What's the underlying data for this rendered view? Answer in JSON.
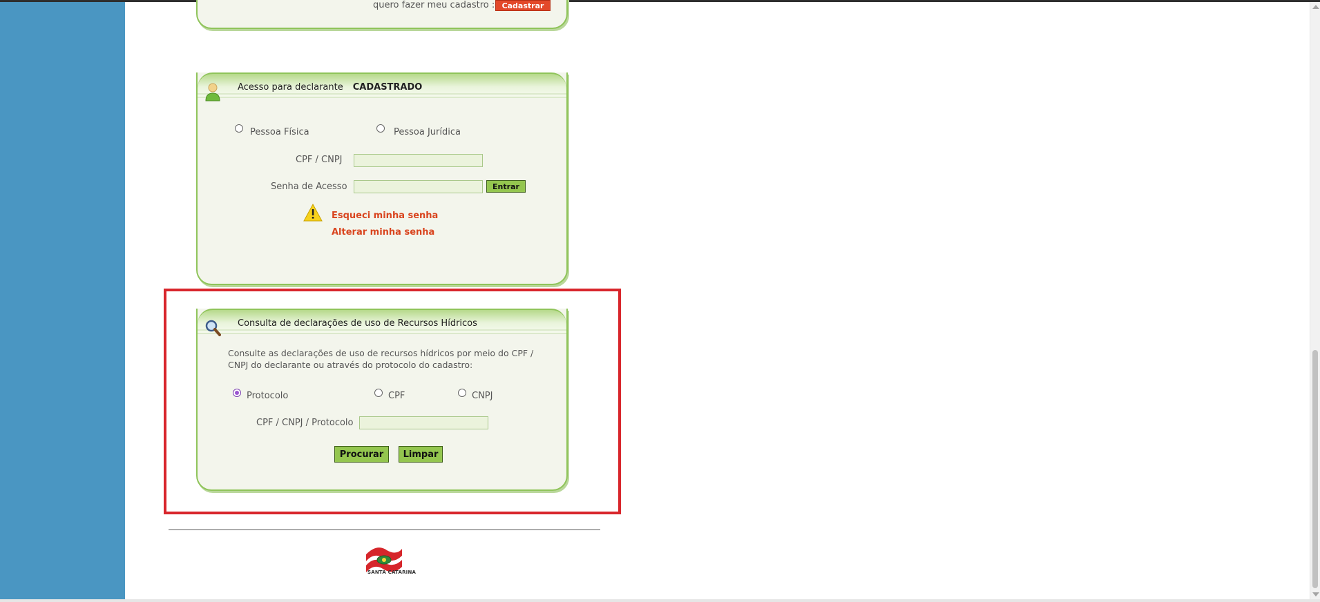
{
  "top_panel": {
    "text": "quero fazer meu cadastro :",
    "register_button": "Cadastrar"
  },
  "access_panel": {
    "title": "Acesso para declarante",
    "title_bold": "CADASTRADO",
    "radio_pf": "Pessoa Física",
    "radio_pj": "Pessoa Jurídica",
    "cpf_label": "CPF / CNPJ",
    "cpf_value": "",
    "password_label": "Senha de Acesso",
    "password_value": "",
    "enter_button": "Entrar",
    "forgot_link": "Esqueci minha senha",
    "change_link": "Alterar minha senha"
  },
  "query_panel": {
    "title": "Consulta de declarações de uso de Recursos Hídricos",
    "description": "Consulte as declarações de uso de recursos hídricos por meio do CPF / CNPJ do declarante ou através do protocolo do cadastro:",
    "radio_protocolo": "Protocolo",
    "radio_cpf": "CPF",
    "radio_cnpj": "CNPJ",
    "selected": "Protocolo",
    "search_label": "CPF / CNPJ / Protocolo",
    "search_value": "",
    "search_button": "Procurar",
    "clear_button": "Limpar"
  },
  "footer": {
    "logo_text": "SANTA CATARINA"
  },
  "colors": {
    "sidebar": "#4a96c2",
    "panel_border": "#8fc45a",
    "button": "#94c64f",
    "link_red": "#d9451f",
    "highlight": "#d8262c"
  }
}
